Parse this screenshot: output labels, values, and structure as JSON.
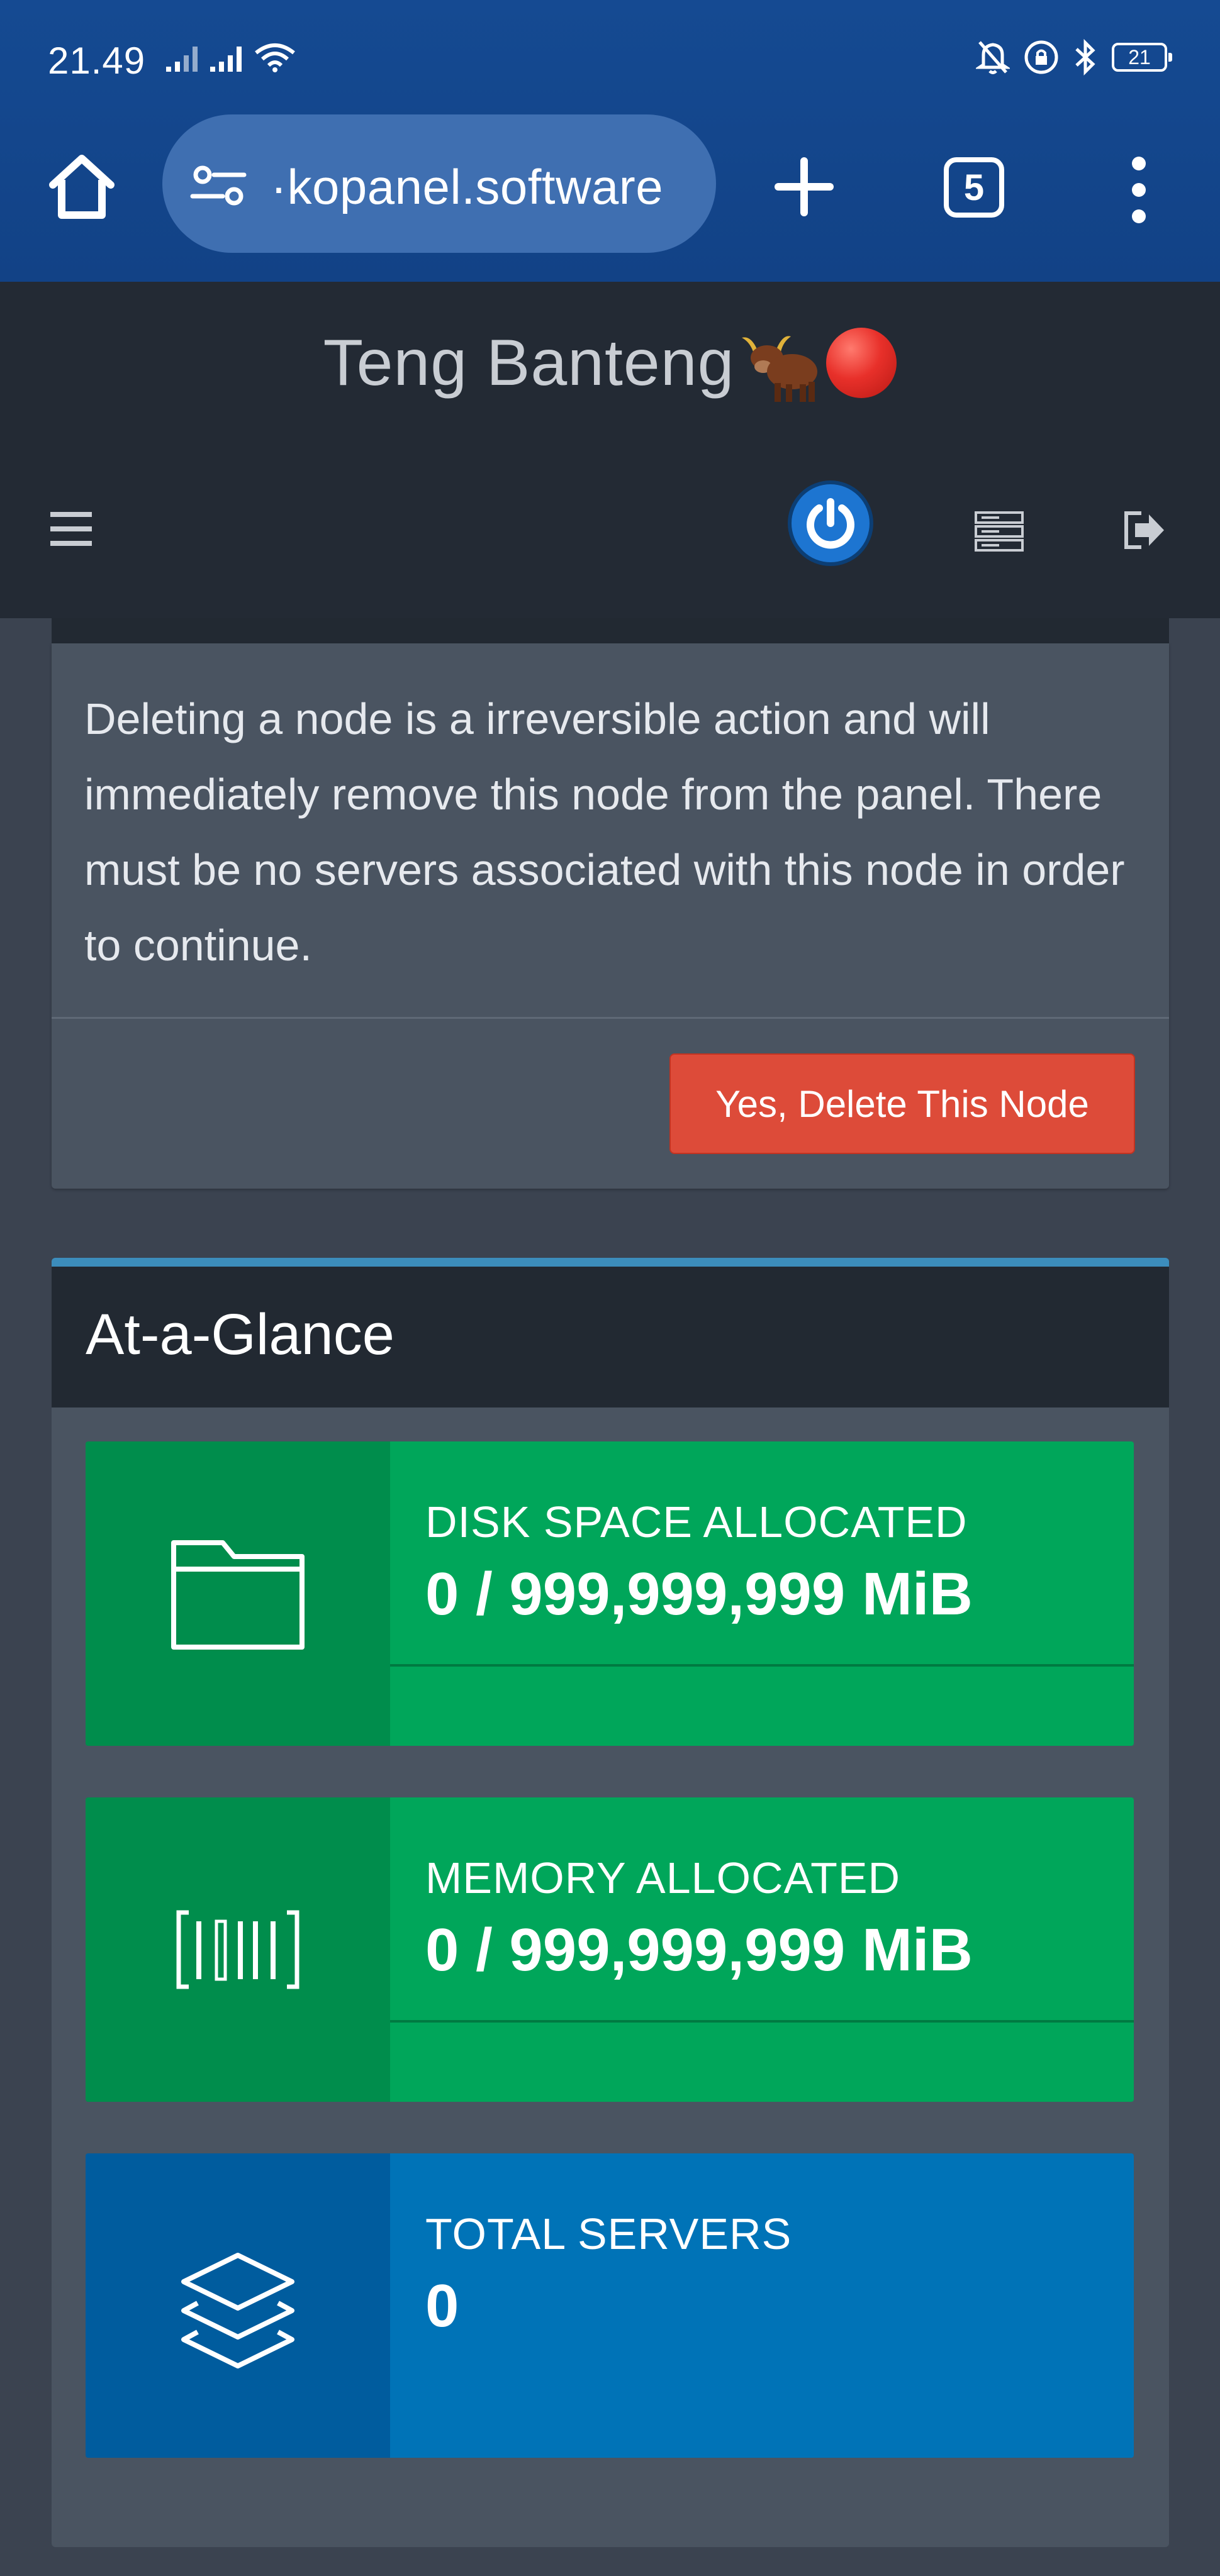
{
  "status_bar": {
    "time": "21.49",
    "battery": "21"
  },
  "browser": {
    "url": "·kopanel.software",
    "tab_count": "5"
  },
  "panel": {
    "brand": "Teng Banteng",
    "brand_emoji_names": [
      "ox-icon",
      "red-circle-icon"
    ]
  },
  "delete_section": {
    "message": "Deleting a node is a irreversible action and will immediately remove this node from the panel. There must be no servers associated with this node in order to continue.",
    "button_label": "Yes, Delete This Node"
  },
  "glance": {
    "title": "At-a-Glance",
    "boxes": [
      {
        "icon": "folder-icon",
        "label": "DISK SPACE ALLOCATED",
        "value": "0 / 999,999,999 MiB",
        "color": "#00a65a"
      },
      {
        "icon": "barcode-icon",
        "label": "MEMORY ALLOCATED",
        "value": "0 / 999,999,999 MiB",
        "color": "#00a65a"
      },
      {
        "icon": "layers-icon",
        "label": "TOTAL SERVERS",
        "value": "0",
        "color": "#0073b7"
      }
    ]
  },
  "colors": {
    "chrome": "#154a92",
    "header": "#232a34",
    "body": "#3b4350",
    "danger": "#dd4b39",
    "success": "#00a65a",
    "primary": "#0073b7"
  }
}
